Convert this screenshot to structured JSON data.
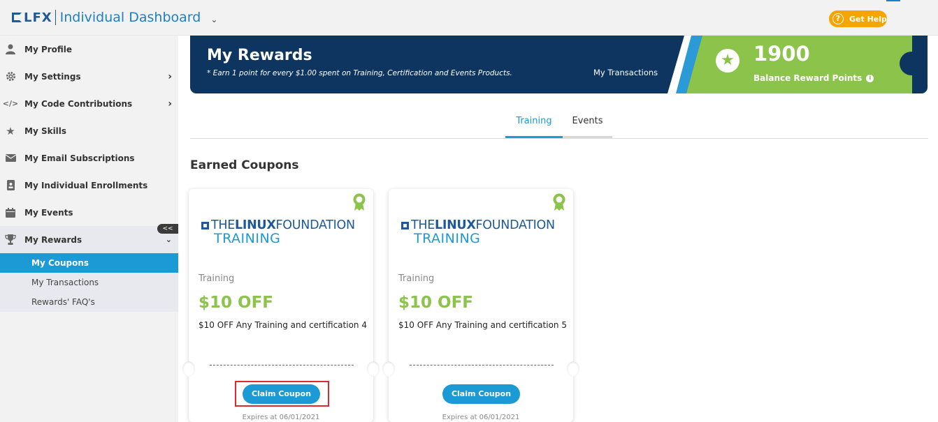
{
  "header": {
    "logo_text": "LFX",
    "title": "Individual Dashboard",
    "help_label": "Get Help"
  },
  "sidebar": {
    "items": [
      {
        "label": "My Profile",
        "icon": "user-icon"
      },
      {
        "label": "My Settings",
        "icon": "gear-icon"
      },
      {
        "label": "My Code Contributions",
        "icon": "code-icon"
      },
      {
        "label": "My Skills",
        "icon": "star-icon"
      },
      {
        "label": "My Email Subscriptions",
        "icon": "envelope-icon"
      },
      {
        "label": "My Individual Enrollments",
        "icon": "id-badge-icon"
      },
      {
        "label": "My Events",
        "icon": "calendar-icon"
      },
      {
        "label": "My Rewards",
        "icon": "trophy-icon"
      }
    ],
    "subitems": [
      {
        "label": "My Coupons",
        "active": true
      },
      {
        "label": "My Transactions",
        "active": false
      },
      {
        "label": "Rewards' FAQ's",
        "active": false
      }
    ],
    "collapse_glyph": "<<"
  },
  "banner": {
    "title": "My Rewards",
    "subtitle": "* Earn 1 point for every $1.00 spent on Training, Certification and Events Products.",
    "transactions_link": "My Transactions",
    "points": "1900",
    "points_label": "Balance Reward Points"
  },
  "tabs": [
    {
      "label": "Training",
      "active": true
    },
    {
      "label": "Events",
      "active": false
    }
  ],
  "section_title": "Earned Coupons",
  "coupons": [
    {
      "logo_line1_pre": "THE",
      "logo_line1_bold": "LINUX",
      "logo_line1_post": "FOUNDATION",
      "logo_line2": "TRAINING",
      "category": "Training",
      "amount": "$10 OFF",
      "description": "$10 OFF Any Training and certification 4",
      "button": "Claim Coupon",
      "expires": "Expires at 06/01/2021"
    },
    {
      "logo_line1_pre": "THE",
      "logo_line1_bold": "LINUX",
      "logo_line1_post": "FOUNDATION",
      "logo_line2": "TRAINING",
      "category": "Training",
      "amount": "$10 OFF",
      "description": "$10 OFF Any Training and certification 5",
      "button": "Claim Coupon",
      "expires": "Expires at 06/01/2021"
    }
  ],
  "colors": {
    "accent": "#1b9ad6",
    "banner": "#0d3560",
    "green": "#8cc34a",
    "help": "#f6a500",
    "highlight": "#e0282e"
  }
}
